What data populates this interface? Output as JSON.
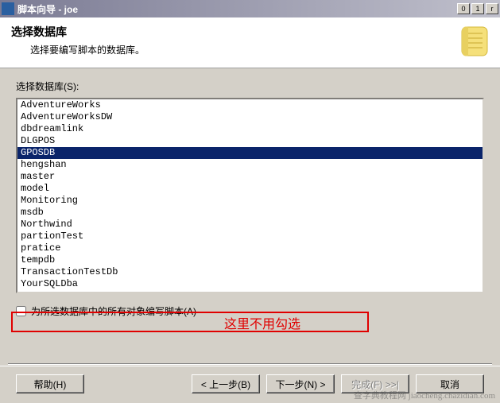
{
  "window": {
    "title": "脚本向导 - joe",
    "min_glyph": "0",
    "max_glyph": "1",
    "close_glyph": "r"
  },
  "header": {
    "title": "选择数据库",
    "subtitle": "选择要编写脚本的数据库。"
  },
  "list": {
    "label": "选择数据库(S):",
    "items": [
      {
        "name": "AdventureWorks",
        "selected": false
      },
      {
        "name": "AdventureWorksDW",
        "selected": false
      },
      {
        "name": "dbdreamlink",
        "selected": false
      },
      {
        "name": "DLGPOS",
        "selected": false
      },
      {
        "name": "GPOSDB",
        "selected": true
      },
      {
        "name": "hengshan",
        "selected": false
      },
      {
        "name": "master",
        "selected": false
      },
      {
        "name": "model",
        "selected": false
      },
      {
        "name": "Monitoring",
        "selected": false
      },
      {
        "name": "msdb",
        "selected": false
      },
      {
        "name": "Northwind",
        "selected": false
      },
      {
        "name": "partionTest",
        "selected": false
      },
      {
        "name": "pratice",
        "selected": false
      },
      {
        "name": "tempdb",
        "selected": false
      },
      {
        "name": "TransactionTestDb",
        "selected": false
      },
      {
        "name": "YourSQLDba",
        "selected": false
      }
    ]
  },
  "checkbox": {
    "label": "为所选数据库中的所有对象编写脚本(A)",
    "checked": false
  },
  "annotation": {
    "text": "这里不用勾选"
  },
  "buttons": {
    "help": "帮助(H)",
    "back": "< 上一步(B)",
    "next": "下一步(N) >",
    "finish": "完成(F) >>|",
    "cancel": "取消"
  },
  "watermark": "查字典教程网 jiaocheng.chazidian.com"
}
